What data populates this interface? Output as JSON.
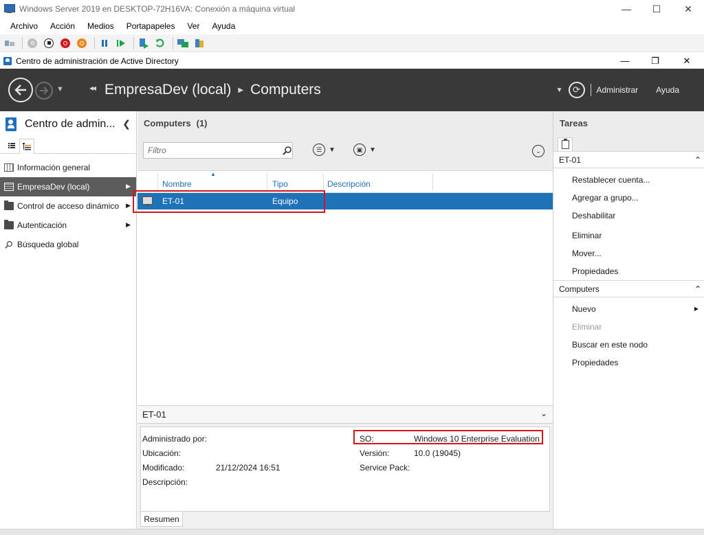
{
  "vm_window": {
    "title": "Windows Server 2019 en DESKTOP-72H16VA: Conexión a máquina virtual",
    "minimize": "—",
    "maximize": "☐",
    "close": "✕",
    "menu": [
      "Archivo",
      "Acción",
      "Medios",
      "Portapapeles",
      "Ver",
      "Ayuda"
    ],
    "toolbar_icons": [
      "ctrl-alt-del-icon",
      "start-icon",
      "turn-off-icon",
      "shutdown-icon",
      "save-icon",
      "pause-icon",
      "resume-icon",
      "checkpoint-icon",
      "revert-icon",
      "enhanced-session-icon",
      "share-icon"
    ]
  },
  "ad_window": {
    "title": "Centro de administración de Active Directory",
    "minimize": "—",
    "restore": "❐",
    "close": "✕"
  },
  "navbar": {
    "breadcrumb": [
      "EmpresaDev (local)",
      "Computers"
    ],
    "manage": "Administrar",
    "help": "Ayuda"
  },
  "left_pane": {
    "title": "Centro de admin...",
    "items": [
      {
        "label": "Información general",
        "selected": false,
        "has_arrow": false
      },
      {
        "label": "EmpresaDev (local)",
        "selected": true,
        "has_arrow": true
      },
      {
        "label": "Control de acceso dinámico",
        "selected": false,
        "has_arrow": true
      },
      {
        "label": "Autenticación",
        "selected": false,
        "has_arrow": true
      },
      {
        "label": "Búsqueda global",
        "selected": false,
        "has_arrow": false
      }
    ]
  },
  "center": {
    "header_title": "Computers",
    "header_count": "(1)",
    "filter_placeholder": "Filtro",
    "columns": [
      "Nombre",
      "Tipo",
      "Descripción"
    ],
    "rows": [
      {
        "name": "ET-01",
        "type": "Equipo",
        "description": "",
        "selected": true
      }
    ]
  },
  "details": {
    "title": "ET-01",
    "labels": {
      "managed_by": "Administrado por:",
      "location": "Ubicación:",
      "modified": "Modificado:",
      "description": "Descripción:",
      "os": "SO:",
      "version": "Versión:",
      "service_pack": "Service Pack:"
    },
    "values": {
      "managed_by": "",
      "location": "",
      "modified": "21/12/2024 16:51",
      "description": "",
      "os": "Windows 10 Enterprise Evaluation",
      "version": "10.0 (19045)",
      "service_pack": ""
    },
    "tab": "Resumen"
  },
  "tasks": {
    "title": "Tareas",
    "sections": [
      {
        "title": "ET-01",
        "items": [
          {
            "label": "Restablecer cuenta...",
            "disabled": false,
            "submenu": false
          },
          {
            "label": "Agregar a grupo...",
            "disabled": false,
            "submenu": false
          },
          {
            "label": "Deshabilitar",
            "disabled": false,
            "submenu": false
          },
          {
            "label": "Eliminar",
            "disabled": false,
            "submenu": false
          },
          {
            "label": "Mover...",
            "disabled": false,
            "submenu": false
          },
          {
            "label": "Propiedades",
            "disabled": false,
            "submenu": false
          }
        ]
      },
      {
        "title": "Computers",
        "items": [
          {
            "label": "Nuevo",
            "disabled": false,
            "submenu": true
          },
          {
            "label": "Eliminar",
            "disabled": true,
            "submenu": false
          },
          {
            "label": "Buscar en este nodo",
            "disabled": false,
            "submenu": false
          },
          {
            "label": "Propiedades",
            "disabled": false,
            "submenu": false
          }
        ]
      }
    ]
  },
  "colors": {
    "nav_dark": "#393939",
    "selection_blue": "#1e72b8",
    "left_selected": "#5c5c5c",
    "link_blue": "#1e6fbf",
    "highlight_red": "#d7141a"
  }
}
